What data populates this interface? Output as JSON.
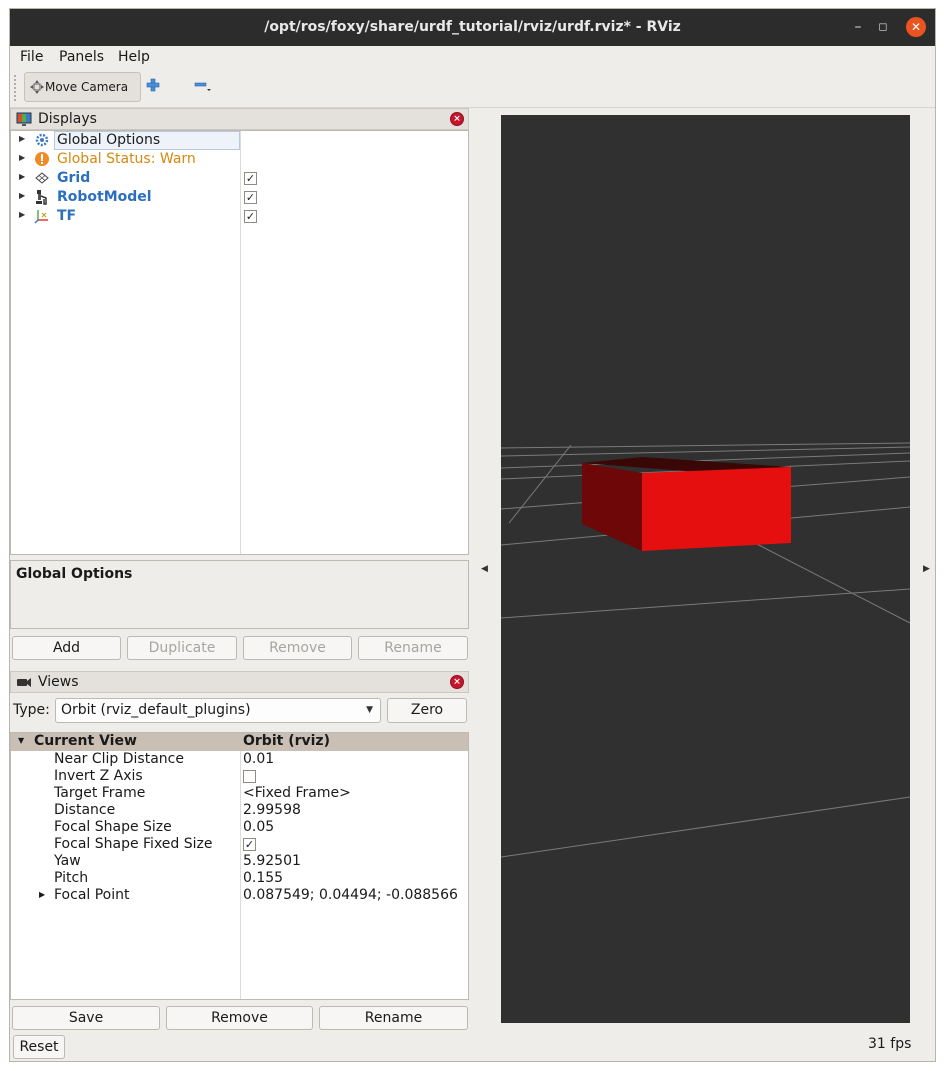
{
  "window": {
    "title": "/opt/ros/foxy/share/urdf_tutorial/rviz/urdf.rviz* - RViz"
  },
  "menu": {
    "file": "File",
    "panels": "Panels",
    "help": "Help"
  },
  "toolbar": {
    "move_camera": "Move Camera"
  },
  "displays": {
    "title": "Displays",
    "items": [
      {
        "label": "Global Options",
        "icon": "gear-icon"
      },
      {
        "label": "Global Status: Warn",
        "icon": "warning-icon"
      },
      {
        "label": "Grid",
        "icon": "grid-icon",
        "checked": true
      },
      {
        "label": "RobotModel",
        "icon": "robot-icon",
        "checked": true
      },
      {
        "label": "TF",
        "icon": "axes-icon",
        "checked": true
      }
    ],
    "description_title": "Global Options",
    "buttons": {
      "add": "Add",
      "duplicate": "Duplicate",
      "remove": "Remove",
      "rename": "Rename"
    }
  },
  "views": {
    "title": "Views",
    "type_label": "Type:",
    "type_value": "Orbit (rviz_default_plugins)",
    "zero": "Zero",
    "current_view": {
      "key": "Current View",
      "value": "Orbit (rviz)"
    },
    "properties": [
      {
        "key": "Near Clip Distance",
        "value": "0.01"
      },
      {
        "key": "Invert Z Axis",
        "checkbox": false
      },
      {
        "key": "Target Frame",
        "value": "<Fixed Frame>"
      },
      {
        "key": "Distance",
        "value": "2.99598"
      },
      {
        "key": "Focal Shape Size",
        "value": "0.05"
      },
      {
        "key": "Focal Shape Fixed Size",
        "checkbox": true
      },
      {
        "key": "Yaw",
        "value": "5.92501"
      },
      {
        "key": "Pitch",
        "value": "0.155"
      },
      {
        "key": "Focal Point",
        "value": "0.087549; 0.04494; -0.088566"
      }
    ],
    "buttons": {
      "save": "Save",
      "remove": "Remove",
      "rename": "Rename"
    }
  },
  "reset": "Reset",
  "fps": "31 fps",
  "colors": {
    "accent": "#e95420",
    "link_blue": "#2d6fbf",
    "warn": "#d4890f",
    "viewport_bg": "#303030",
    "box_front": "#e60f0f",
    "box_side": "#6e0707",
    "box_top": "#3d0505"
  }
}
